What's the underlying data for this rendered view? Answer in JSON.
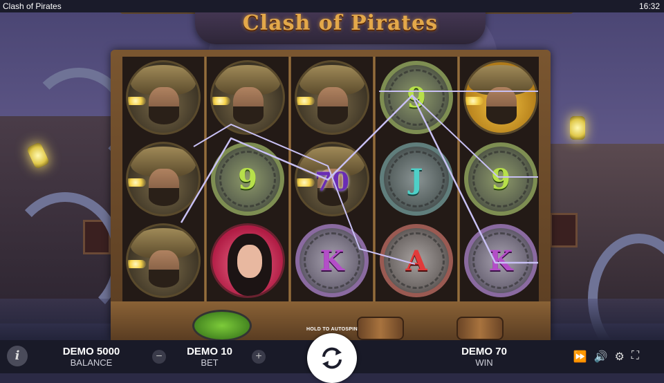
{
  "window": {
    "title": "Clash of Pirates",
    "clock": "16:32",
    "help_mark": "?"
  },
  "game": {
    "logo": "Clash of Pirates",
    "reels": [
      [
        {
          "type": "captain",
          "style": "dark"
        },
        {
          "type": "captain",
          "style": "dark"
        },
        {
          "type": "captain",
          "style": "dark"
        }
      ],
      [
        {
          "type": "captain",
          "style": "dark"
        },
        {
          "type": "coin",
          "color": "green",
          "label": "9"
        },
        {
          "type": "lady"
        }
      ],
      [
        {
          "type": "captain",
          "style": "dark"
        },
        {
          "type": "captain",
          "style": "dark",
          "win": "70"
        },
        {
          "type": "coin",
          "color": "purple",
          "label": "K"
        }
      ],
      [
        {
          "type": "coin",
          "color": "green",
          "label": "9"
        },
        {
          "type": "coin",
          "color": "teal",
          "label": "J"
        },
        {
          "type": "coin",
          "color": "red",
          "label": "A"
        }
      ],
      [
        {
          "type": "captain",
          "style": "gold"
        },
        {
          "type": "coin",
          "color": "green",
          "label": "9"
        },
        {
          "type": "coin",
          "color": "purple",
          "label": "K"
        }
      ]
    ],
    "payline_color": "#c8c0f4"
  },
  "bottom": {
    "info_icon": "i",
    "balance": {
      "value": "DEMO 5000",
      "label": "BALANCE"
    },
    "bet": {
      "value": "DEMO 10",
      "label": "BET",
      "minus": "−",
      "plus": "+"
    },
    "spin": {
      "hint": "HOLD TO AUTOSPIN"
    },
    "win": {
      "value": "DEMO 70",
      "label": "WIN"
    },
    "tools": [
      "fast-forward-icon",
      "volume-icon",
      "settings-icon",
      "fullscreen-icon"
    ]
  }
}
